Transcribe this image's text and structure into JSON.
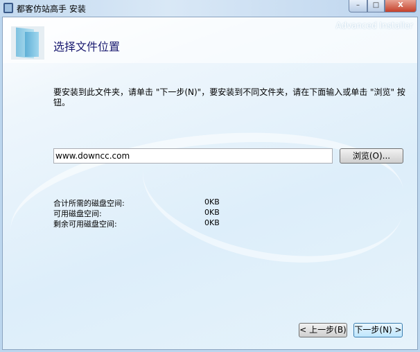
{
  "window": {
    "title": "都客仿站高手 安装",
    "min": "–",
    "max": "□",
    "close": "X"
  },
  "header": {
    "brand": "Advanced Installer",
    "title": "选择文件位置"
  },
  "body": {
    "description": "要安装到此文件夹，请单击 \"下一步(N)\"，要安装到不同文件夹，请在下面输入或单击 \"浏览\" 按钮。",
    "path_value": "www.downcc.com",
    "browse_label": "浏览(O)...",
    "disk": [
      {
        "label": "合计所需的磁盘空间:",
        "value": "0KB"
      },
      {
        "label": "可用磁盘空间:",
        "value": "0KB"
      },
      {
        "label": "剩余可用磁盘空间:",
        "value": "0KB"
      }
    ]
  },
  "footer": {
    "back_label": "< 上一步(B)",
    "next_label": "下一步(N) >"
  }
}
